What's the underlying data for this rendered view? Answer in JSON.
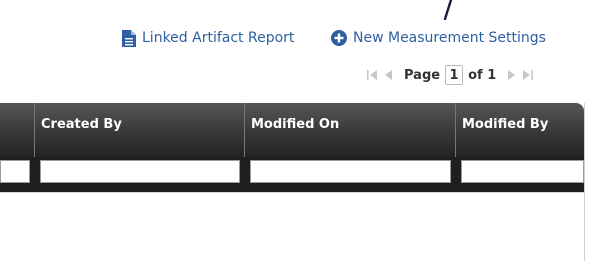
{
  "toolbar": {
    "linked_report_label": "Linked Artifact Report",
    "new_measurement_label": "New Measurement Settings",
    "report_icon": "document-icon",
    "add_icon": "plus-circle-icon",
    "accent_color": "#2e5fa3"
  },
  "pager": {
    "page_label": "Page",
    "current_page": "1",
    "of_label": "of 1"
  },
  "grid": {
    "columns": [
      {
        "label": "Created By"
      },
      {
        "label": "Modified On"
      },
      {
        "label": "Modified By"
      }
    ],
    "header_color": "#2f2f2f"
  }
}
